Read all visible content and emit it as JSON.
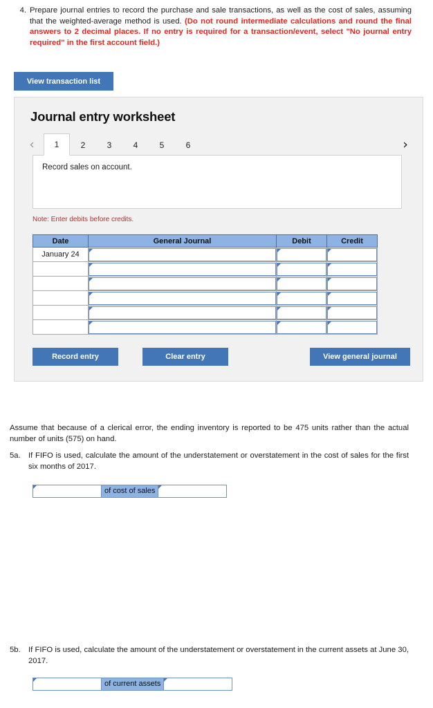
{
  "question4": {
    "number": "4.",
    "text_plain_1": "Prepare journal entries to record the purchase and sale transactions, as well as the cost of sales, assuming that the weighted-average method is used. ",
    "text_red": "(Do not round intermediate calculations and round the final answers to 2 decimal places. If no entry is required for a transaction/event, select \"No journal entry required\" in the first account field.)"
  },
  "buttons": {
    "view_transaction_list": "View transaction list",
    "record_entry": "Record entry",
    "clear_entry": "Clear entry",
    "view_general_journal": "View general journal"
  },
  "worksheet": {
    "title": "Journal entry worksheet",
    "prev_arrow": "‹",
    "next_arrow": "›",
    "tabs": [
      {
        "label": "1",
        "active": true
      },
      {
        "label": "2",
        "active": false
      },
      {
        "label": "3",
        "active": false
      },
      {
        "label": "4",
        "active": false
      },
      {
        "label": "5",
        "active": false
      },
      {
        "label": "6",
        "active": false
      }
    ],
    "description": "Record sales on account.",
    "note": "Note: Enter debits before credits.",
    "table": {
      "headers": [
        "Date",
        "General Journal",
        "Debit",
        "Credit"
      ],
      "rows": [
        {
          "date": "January 24",
          "general_journal": "",
          "debit": "",
          "credit": ""
        },
        {
          "date": "",
          "general_journal": "",
          "debit": "",
          "credit": ""
        },
        {
          "date": "",
          "general_journal": "",
          "debit": "",
          "credit": ""
        },
        {
          "date": "",
          "general_journal": "",
          "debit": "",
          "credit": ""
        },
        {
          "date": "",
          "general_journal": "",
          "debit": "",
          "credit": ""
        },
        {
          "date": "",
          "general_journal": "",
          "debit": "",
          "credit": ""
        }
      ]
    }
  },
  "assume_text": "Assume that because of a clerical error, the ending inventory is reported to be 475 units rather than the actual number of units (575) on hand.",
  "question5a": {
    "number": "5a.",
    "text": "If FIFO is used, calculate the amount of the understatement or overstatement in the cost of sales for the first six months of 2017.",
    "answer_left_value": "",
    "answer_label": "of cost of sales",
    "answer_right_value": ""
  },
  "question5b": {
    "number": "5b.",
    "text": "If FIFO is used, calculate the amount of the understatement or overstatement in the current assets at June 30, 2017.",
    "answer_left_value": "",
    "answer_label": "of current assets",
    "answer_right_value": ""
  },
  "colors": {
    "button_blue": "#4276b6",
    "header_blue": "#8db3e2",
    "red_text": "#e8251e",
    "note_red": "#b5302b",
    "panel_gray": "#f1f1f1"
  }
}
